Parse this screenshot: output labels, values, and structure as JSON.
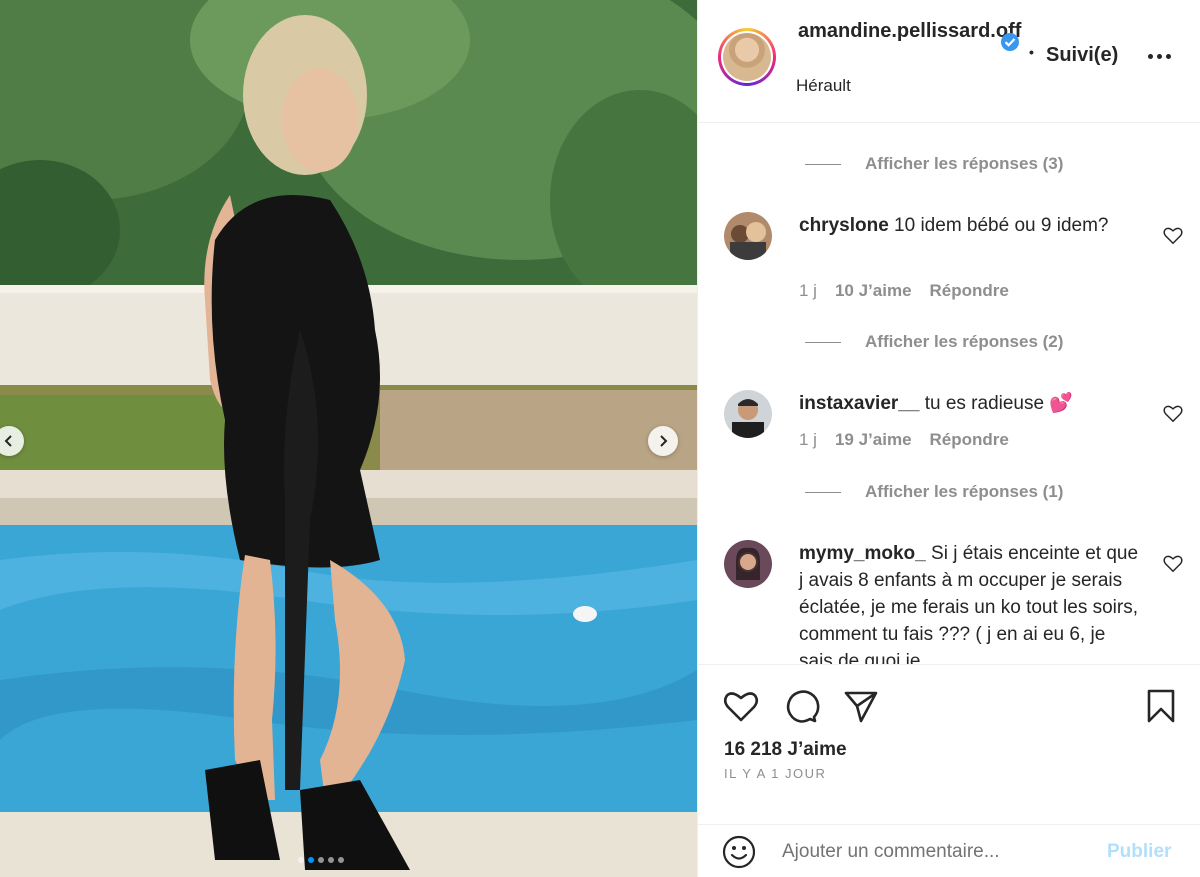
{
  "post": {
    "username": "amandine.pellissard.off",
    "follow_separator": "•",
    "follow_label": "Suivi(e)",
    "location": "Hérault",
    "likes": "16 218 J’aime",
    "time": "IL Y A 1 JOUR"
  },
  "comments": [
    {
      "type": "replies",
      "label": "Afficher les réponses (3)"
    },
    {
      "type": "comment",
      "user": "chryslone",
      "text": "10 idem bébé ou 9 idem?",
      "age": "1 j",
      "likes": "10 J’aime",
      "reply": "Répondre"
    },
    {
      "type": "replies",
      "label": "Afficher les réponses (2)"
    },
    {
      "type": "comment",
      "user": "instaxavier__",
      "text": "tu es radieuse 💕",
      "age": "1 j",
      "likes": "19 J’aime",
      "reply": "Répondre"
    },
    {
      "type": "replies",
      "label": "Afficher les réponses (1)"
    },
    {
      "type": "comment",
      "user": "mymy_moko_",
      "text": "Si j étais enceinte et que j avais 8 enfants à m occuper je serais éclatée, je me ferais un ko tout les soirs, comment tu fais ??? ( j en ai eu 6, je sais de quoi je"
    }
  ],
  "composer": {
    "placeholder": "Ajouter un commentaire...",
    "publish_label": "Publier"
  },
  "media": {
    "slide_count": 5,
    "active_slide": 1
  },
  "colors": {
    "verified": "#3897f0",
    "link_disabled": "#b2dffc",
    "muted": "#8e8e8e",
    "text": "#262626"
  },
  "icons": [
    "chevron-left-icon",
    "chevron-right-icon",
    "verified-badge-icon",
    "more-options-icon",
    "heart-icon",
    "comment-icon",
    "share-icon",
    "bookmark-icon",
    "emoji-icon"
  ]
}
